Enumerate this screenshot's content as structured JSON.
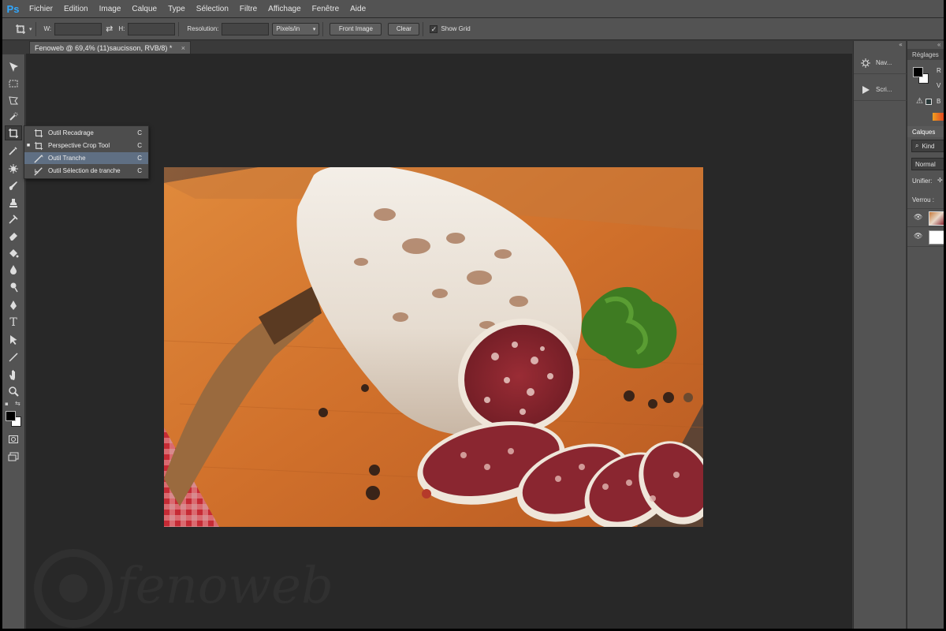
{
  "app": {
    "logo": "Ps"
  },
  "menu": [
    "Fichier",
    "Edition",
    "Image",
    "Calque",
    "Type",
    "Sélection",
    "Filtre",
    "Affichage",
    "Fenêtre",
    "Aide"
  ],
  "options": {
    "w_label": "W:",
    "h_label": "H:",
    "swap_icon": "swap-arrows-icon",
    "resolution_label": "Resolution:",
    "units": "Pixels/in",
    "front_image": "Front Image",
    "clear": "Clear",
    "show_grid": "Show Grid",
    "show_grid_checked": true
  },
  "document": {
    "tab_title": "Fenoweb @ 69,4% (11)saucisson, RVB/8) *",
    "close": "×"
  },
  "flyout": {
    "items": [
      {
        "label": "Outil Recadrage",
        "key": "C",
        "icon": "crop-icon",
        "active": false,
        "selected": false
      },
      {
        "label": "Perspective Crop Tool",
        "key": "C",
        "icon": "perspective-crop-icon",
        "active": true,
        "selected": false
      },
      {
        "label": "Outil Tranche",
        "key": "C",
        "icon": "slice-icon",
        "active": false,
        "selected": true
      },
      {
        "label": "Outil Sélection de tranche",
        "key": "C",
        "icon": "slice-select-icon",
        "active": false,
        "selected": false
      }
    ]
  },
  "mid_panel": {
    "items": [
      {
        "label": "Nav...",
        "icon": "navigator-icon"
      },
      {
        "label": "Scri...",
        "icon": "play-icon"
      }
    ]
  },
  "right_panel": {
    "adjust_tab": "Réglages",
    "color_r": "R",
    "color_v": "V",
    "color_b": "B",
    "layers_tab": "Calques",
    "kind": "Kind",
    "blend_mode": "Normal",
    "unify": "Unifier:",
    "lock": "Verrou :"
  },
  "watermark": "fenoweb",
  "colors": {
    "accent": "#31a8ff",
    "selection": "#5f6f83",
    "panel": "#535353",
    "workspace": "#282828"
  }
}
